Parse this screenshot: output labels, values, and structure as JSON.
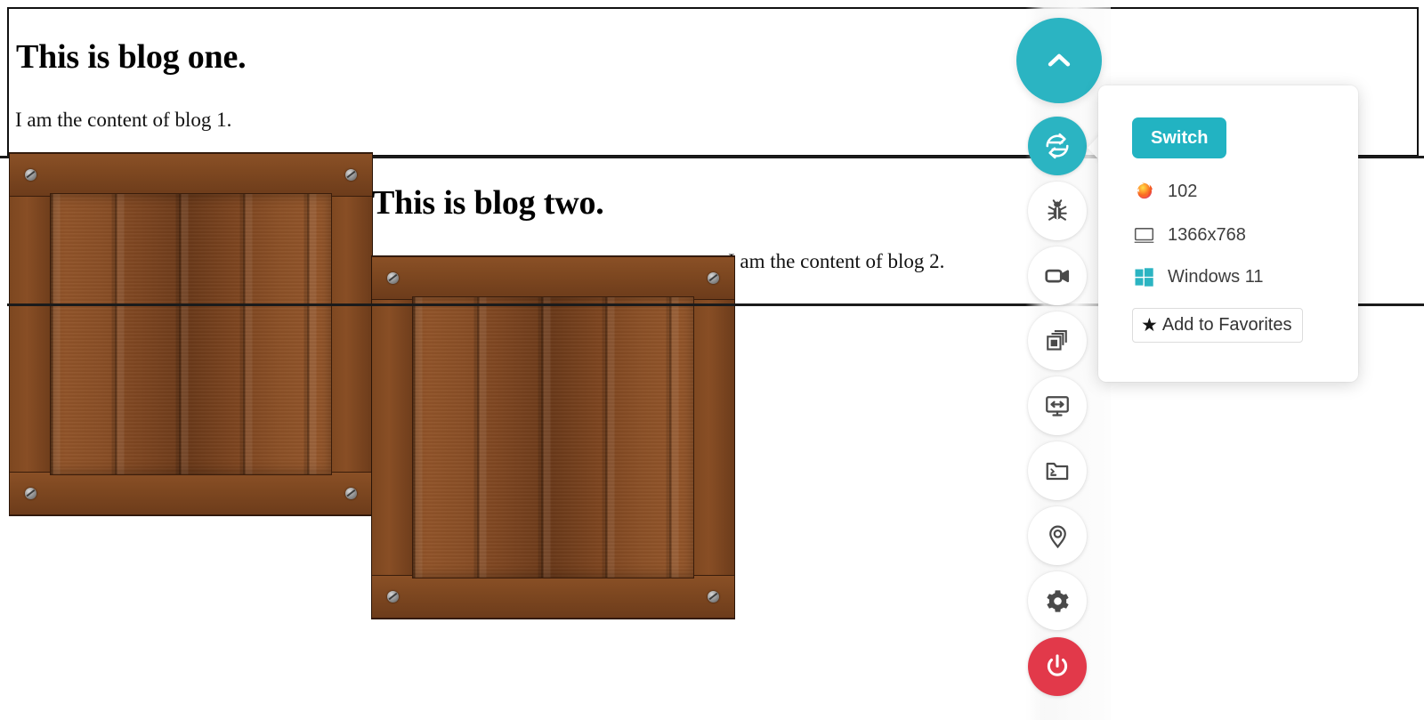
{
  "document": {
    "blogs": [
      {
        "title": "This is blog one.",
        "body": "I am the content of blog 1.",
        "image": "wooden-crate-image"
      },
      {
        "title": "This is blog two.",
        "body": "I am the content of blog 2.",
        "image": "wooden-crate-image"
      }
    ]
  },
  "sidebar": {
    "buttons": [
      {
        "name": "collapse-toggle",
        "icon": "chevron-up-icon",
        "style": "teal"
      },
      {
        "name": "switch-device",
        "icon": "switch-arrows-icon",
        "style": "teal"
      },
      {
        "name": "report-bug",
        "icon": "bug-icon",
        "style": "white"
      },
      {
        "name": "record-session",
        "icon": "video-camera-icon",
        "style": "white"
      },
      {
        "name": "screenshots",
        "icon": "copies-icon",
        "style": "white"
      },
      {
        "name": "resize-screen",
        "icon": "monitor-resize-icon",
        "style": "white"
      },
      {
        "name": "file-manager",
        "icon": "folder-terminal-icon",
        "style": "white"
      },
      {
        "name": "geolocation",
        "icon": "map-pin-icon",
        "style": "white"
      },
      {
        "name": "settings",
        "icon": "gear-icon",
        "style": "white"
      },
      {
        "name": "power-stop",
        "icon": "power-icon",
        "style": "red"
      }
    ]
  },
  "popup": {
    "switch_label": "Switch",
    "rows": [
      {
        "icon": "firefox-icon",
        "label": "102"
      },
      {
        "icon": "monitor-icon",
        "label": "1366x768"
      },
      {
        "icon": "windows-icon",
        "label": "Windows 11"
      }
    ],
    "favorites_label": "Add to Favorites",
    "favorites_icon": "star-icon"
  },
  "colors": {
    "teal": "#2bb4c2",
    "red": "#e2394a",
    "panel_bg": "#ffffff",
    "text": "#3e3e3e",
    "windows_blue": "#2bb4c2"
  }
}
